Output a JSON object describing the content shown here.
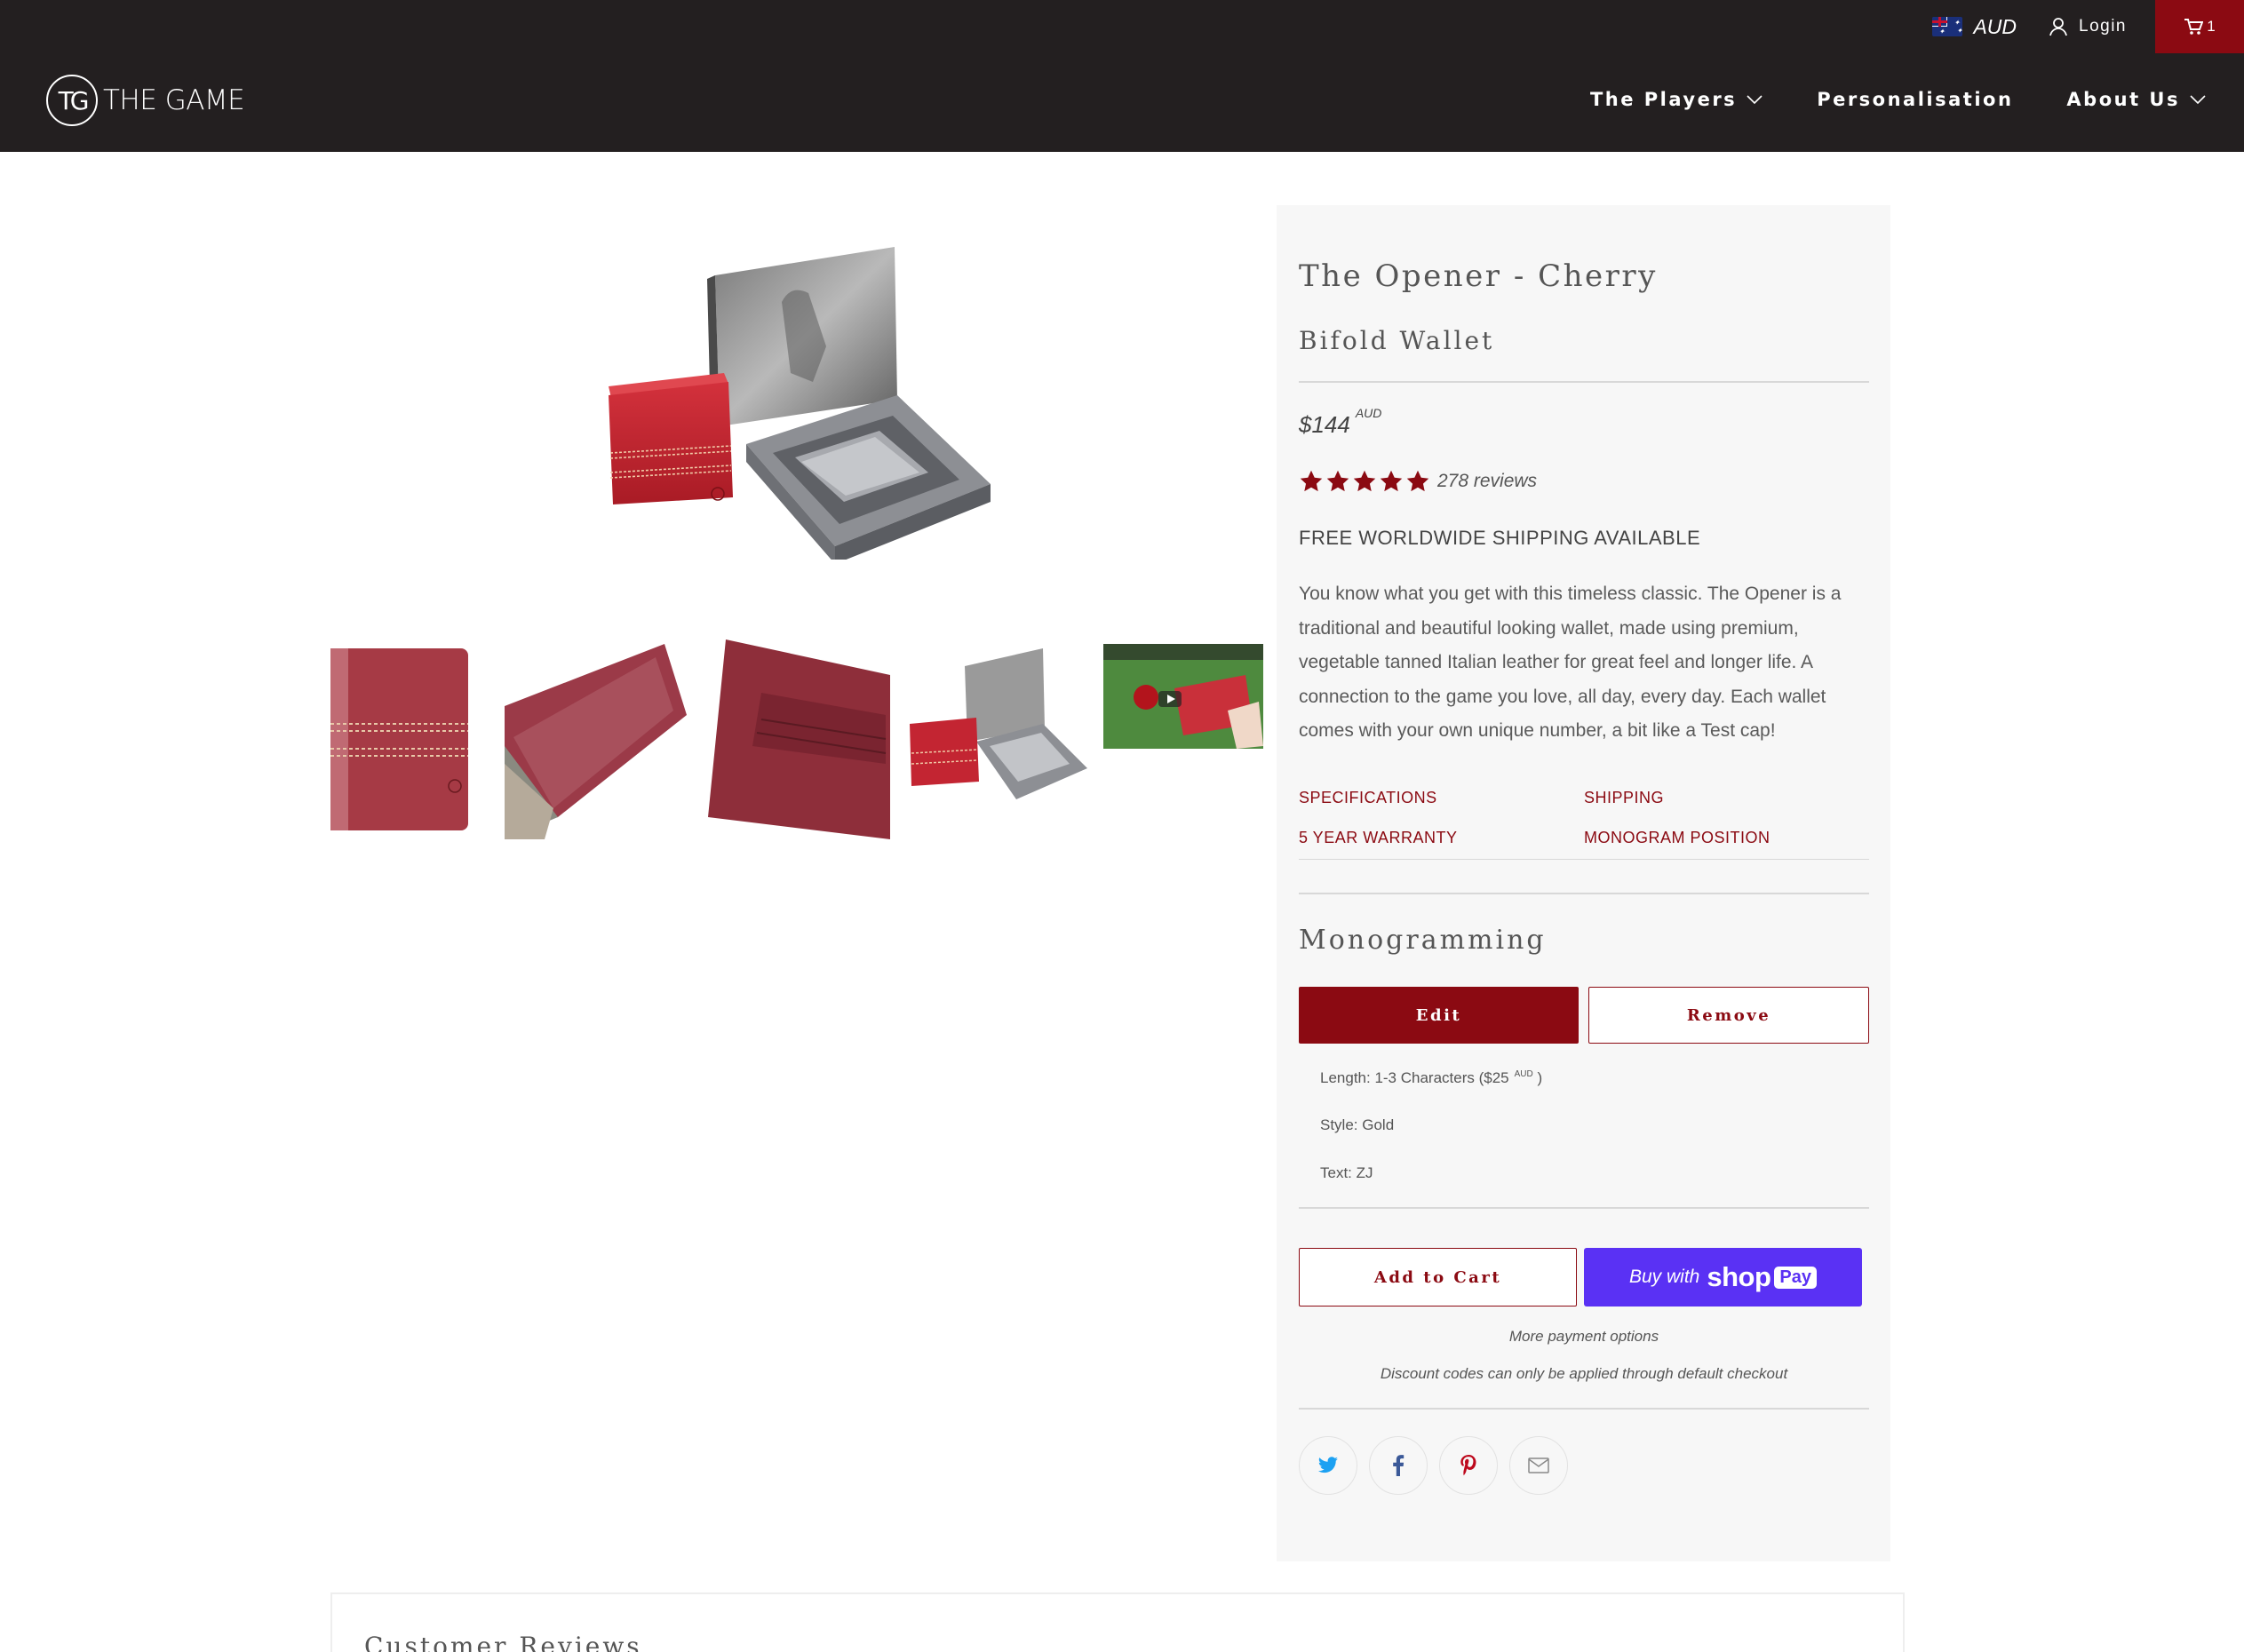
{
  "header": {
    "currency": "AUD",
    "login_label": "Login",
    "cart_count": "1",
    "logo_mark": "TG",
    "logo_text": "THE GAME",
    "nav": [
      {
        "label": "The Players"
      },
      {
        "label": "Personalisation"
      },
      {
        "label": "About Us"
      }
    ]
  },
  "product": {
    "title": "The Opener - Cherry",
    "subtitle": "Bifold Wallet",
    "price": "$144",
    "price_currency": "AUD",
    "rating_stars": 5,
    "reviews_label": "278 reviews",
    "shipping_note": "FREE WORLDWIDE SHIPPING AVAILABLE",
    "description": "You know what you get with this timeless classic. The Opener is a traditional and beautiful looking wallet, made using premium, vegetable tanned Italian leather for great feel and longer life. A connection to the game you love, all day, every day. Each wallet comes with your own unique number, a bit like a Test cap!",
    "tabs": [
      "SPECIFICATIONS",
      "SHIPPING",
      "5 YEAR WARRANTY",
      "MONOGRAM POSITION"
    ]
  },
  "monogramming": {
    "title": "Monogramming",
    "edit_label": "Edit",
    "remove_label": "Remove",
    "length_label": "Length: 1-3 Characters ($25",
    "length_currency": "AUD",
    "length_close": ")",
    "style_label": "Style: Gold",
    "text_label": "Text: ZJ"
  },
  "purchase": {
    "add_to_cart": "Add to Cart",
    "buy_with": "Buy with",
    "shop_word": "shop",
    "pay_word": "Pay",
    "more_options": "More payment options",
    "discount_note": "Discount codes can only be applied through default checkout"
  },
  "share": {
    "icons": [
      "twitter-icon",
      "facebook-icon",
      "pinterest-icon",
      "email-icon"
    ]
  },
  "reviews_section": {
    "title": "Customer Reviews"
  },
  "colors": {
    "header_bg": "#231f20",
    "accent": "#8b0a12",
    "shop_pay": "#5a31f4",
    "panel_bg": "#f7f7f7"
  }
}
